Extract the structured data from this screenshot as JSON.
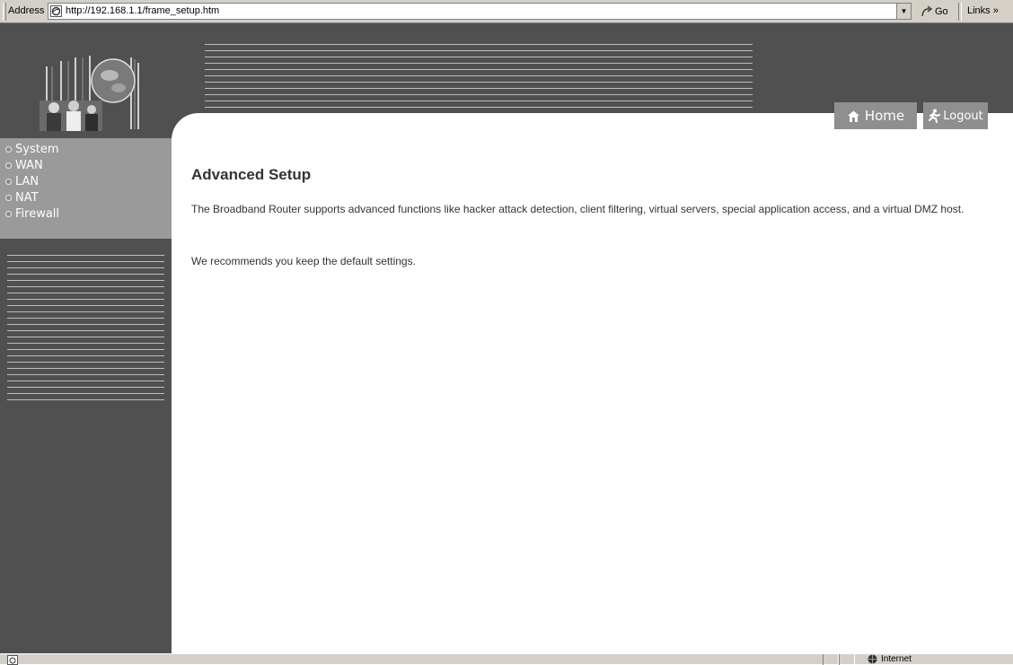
{
  "browser": {
    "address_label": "Address",
    "url": "http://192.168.1.1/frame_setup.htm",
    "go_label": "Go",
    "links_label": "Links »",
    "status_zone": "Internet"
  },
  "header": {
    "home_label": "Home",
    "logout_label": "Logout"
  },
  "sidebar": {
    "items": [
      {
        "label": "System"
      },
      {
        "label": "WAN"
      },
      {
        "label": "LAN"
      },
      {
        "label": "NAT"
      },
      {
        "label": "Firewall"
      }
    ]
  },
  "main": {
    "title": "Advanced Setup",
    "paragraph1": "The Broadband Router supports advanced functions like hacker attack detection, client filtering, virtual servers, special application access, and a virtual DMZ host.",
    "paragraph2": "We recommends you keep the default settings."
  },
  "colors": {
    "frame_gray": "#505050",
    "nav_panel": "#9a9a9a",
    "button_gray": "#8f8f8f"
  }
}
